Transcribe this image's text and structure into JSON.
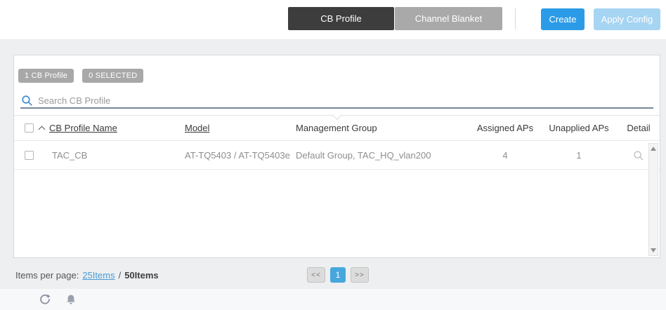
{
  "toolbar": {
    "tabs": [
      {
        "label": "CB Profile",
        "active": true
      },
      {
        "label": "Channel Blanket",
        "active": false
      }
    ],
    "create_label": "Create",
    "apply_config_label": "Apply Config"
  },
  "panel": {
    "badges": [
      {
        "label": "1 CB Profile"
      },
      {
        "label": "0 SELECTED"
      }
    ],
    "search": {
      "placeholder": "Search CB Profile",
      "icon": "search-icon"
    },
    "table": {
      "columns": [
        {
          "label": "CB Profile Name",
          "sorted": "asc",
          "underlined": true
        },
        {
          "label": "Model",
          "underlined": true
        },
        {
          "label": "Management Group",
          "underlined": false
        },
        {
          "label": "Assigned APs",
          "underlined": false
        },
        {
          "label": "Unapplied APs",
          "underlined": false
        },
        {
          "label": "Detail",
          "underlined": false
        }
      ],
      "rows": [
        {
          "name": "TAC_CB",
          "model": "AT-TQ5403 / AT-TQ5403e",
          "management_group": "Default Group, TAC_HQ_vlan200",
          "assigned_aps": "4",
          "unapplied_aps": "1",
          "detail_icon": "magnifier-icon",
          "selected": false
        }
      ]
    }
  },
  "footer": {
    "items_per_page_label": "Items per page:",
    "page_size_selected": "25Items",
    "separator": "/",
    "page_size_max": "50Items",
    "pagination": {
      "first_label": "<<",
      "current_page": "1",
      "last_label": ">>"
    }
  },
  "statusbar": {
    "icons": [
      "refresh-icon",
      "bell-icon"
    ]
  },
  "colors": {
    "accent_blue": "#2b9be8",
    "disabled_blue": "#a6d4f3",
    "tab_active_bg": "#3d3d3d",
    "tab_inactive_bg": "#a9a9a9",
    "badge_bg": "#a8a8a8",
    "link_blue": "#4a9bd5",
    "pagination_active_bg": "#47a7dd",
    "search_underline": "#76879a",
    "page_bg": "#edeff1"
  }
}
